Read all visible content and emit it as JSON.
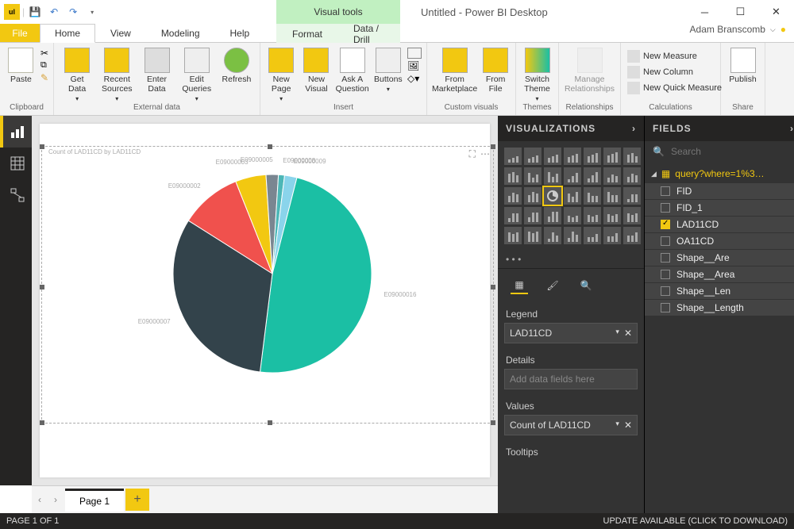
{
  "titlebar": {
    "visual_tools": "Visual tools",
    "title": "Untitled - Power BI Desktop"
  },
  "tabs": {
    "file": "File",
    "home": "Home",
    "view": "View",
    "modeling": "Modeling",
    "help": "Help",
    "format": "Format",
    "data_drill": "Data / Drill"
  },
  "user": "Adam Branscomb",
  "ribbon": {
    "clipboard": {
      "label": "Clipboard",
      "paste": "Paste"
    },
    "external": {
      "label": "External data",
      "get": "Get\nData",
      "recent": "Recent\nSources",
      "enter": "Enter\nData",
      "edit": "Edit\nQueries",
      "refresh": "Refresh"
    },
    "insert": {
      "label": "Insert",
      "newpage": "New\nPage",
      "newvisual": "New\nVisual",
      "ask": "Ask A\nQuestion",
      "buttons": "Buttons"
    },
    "custom": {
      "label": "Custom visuals",
      "marketplace": "From\nMarketplace",
      "file": "From\nFile"
    },
    "themes": {
      "label": "Themes",
      "switch": "Switch\nTheme"
    },
    "relationships": {
      "label": "Relationships",
      "manage": "Manage\nRelationships"
    },
    "calc": {
      "label": "Calculations",
      "measure": "New Measure",
      "column": "New Column",
      "quick": "New Quick Measure"
    },
    "share": {
      "label": "Share",
      "publish": "Publish"
    }
  },
  "viz_pane": {
    "header": "VISUALIZATIONS",
    "legend": "Legend",
    "legend_field": "LAD11CD",
    "details": "Details",
    "add_fields": "Add data fields here",
    "values": "Values",
    "values_field": "Count of LAD11CD",
    "tooltips": "Tooltips"
  },
  "fields_pane": {
    "header": "FIELDS",
    "search_placeholder": "Search",
    "table": "query?where=1%3…",
    "fields": [
      {
        "name": "FID",
        "checked": false
      },
      {
        "name": "FID_1",
        "checked": false
      },
      {
        "name": "LAD11CD",
        "checked": true
      },
      {
        "name": "OA11CD",
        "checked": false
      },
      {
        "name": "Shape__Are",
        "checked": false
      },
      {
        "name": "Shape__Area",
        "checked": false
      },
      {
        "name": "Shape__Len",
        "checked": false
      },
      {
        "name": "Shape__Length",
        "checked": false
      }
    ]
  },
  "page_tabs": {
    "page1": "Page 1"
  },
  "statusbar": {
    "left": "PAGE 1 OF 1",
    "right": "UPDATE AVAILABLE (CLICK TO DOWNLOAD)"
  },
  "chart_data": {
    "type": "pie",
    "title": "Count of LAD11CD by LAD11CD",
    "series_name": "LAD11CD",
    "slices": [
      {
        "label": "E09000016",
        "value": 48,
        "color": "#1bbfa4"
      },
      {
        "label": "E09000007",
        "value": 32,
        "color": "#33434b"
      },
      {
        "label": "E09000002",
        "value": 10,
        "color": "#f0514d"
      },
      {
        "label": "E09000003",
        "value": 5,
        "color": "#f2c811"
      },
      {
        "label": "E09000005",
        "value": 2,
        "color": "#7a8691"
      },
      {
        "label": "E09000008",
        "value": 1,
        "color": "#4cb7b7"
      },
      {
        "label": "E09000009",
        "value": 2,
        "color": "#8ad4eb"
      }
    ]
  }
}
